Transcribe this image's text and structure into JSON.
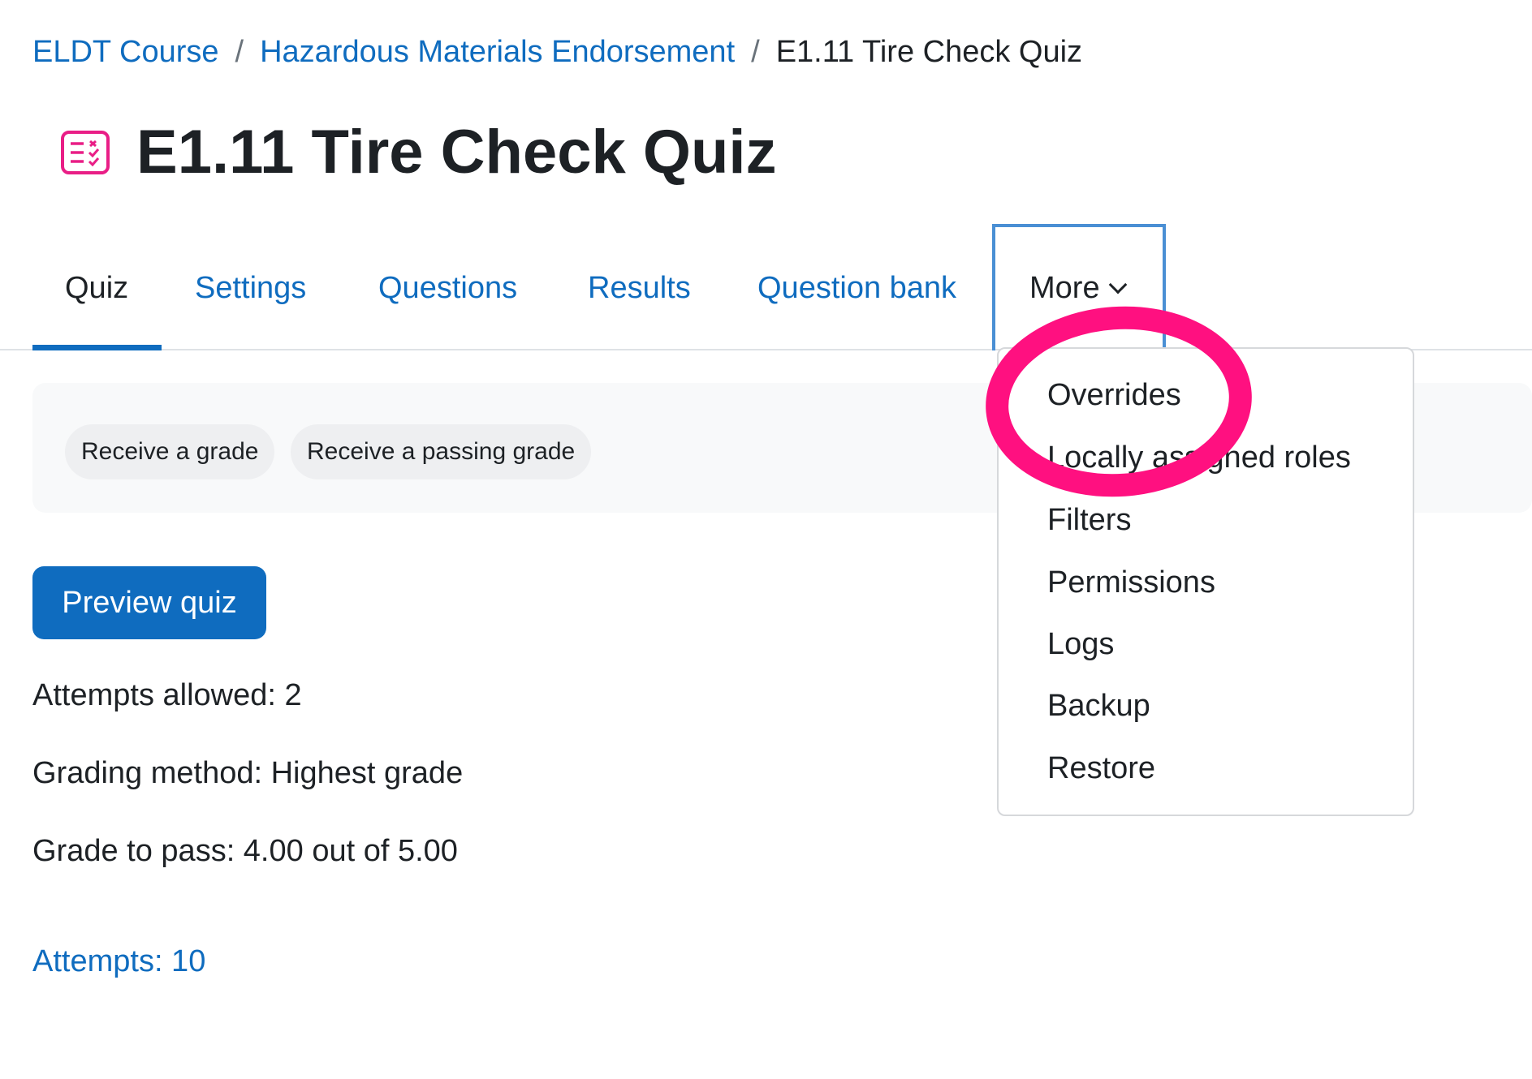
{
  "breadcrumb": {
    "items": [
      "ELDT Course",
      "Hazardous Materials Endorsement"
    ],
    "separator": "/",
    "current": "E1.11 Tire Check Quiz"
  },
  "page": {
    "title": "E1.11 Tire Check Quiz",
    "icon": "quiz-icon",
    "icon_color": "#e91e86"
  },
  "tabs": [
    {
      "label": "Quiz",
      "active": true
    },
    {
      "label": "Settings",
      "active": false
    },
    {
      "label": "Questions",
      "active": false
    },
    {
      "label": "Results",
      "active": false
    },
    {
      "label": "Question bank",
      "active": false
    },
    {
      "label": "More",
      "active": false
    }
  ],
  "more_menu": {
    "items": [
      "Overrides",
      "Locally assigned roles",
      "Filters",
      "Permissions",
      "Logs",
      "Backup",
      "Restore"
    ]
  },
  "completion": {
    "conditions": [
      "Receive a grade",
      "Receive a passing grade"
    ]
  },
  "actions": {
    "preview_label": "Preview quiz"
  },
  "quiz_info": {
    "attempts_allowed": "Attempts allowed: 2",
    "grading_method": "Grading method: Highest grade",
    "grade_to_pass": "Grade to pass: 4.00 out of 5.00"
  },
  "attempts_link": "Attempts: 10",
  "colors": {
    "link": "#0f6cbf",
    "primary_button": "#0f6cbf",
    "annotation": "#ff1080",
    "text": "#1d2125"
  }
}
